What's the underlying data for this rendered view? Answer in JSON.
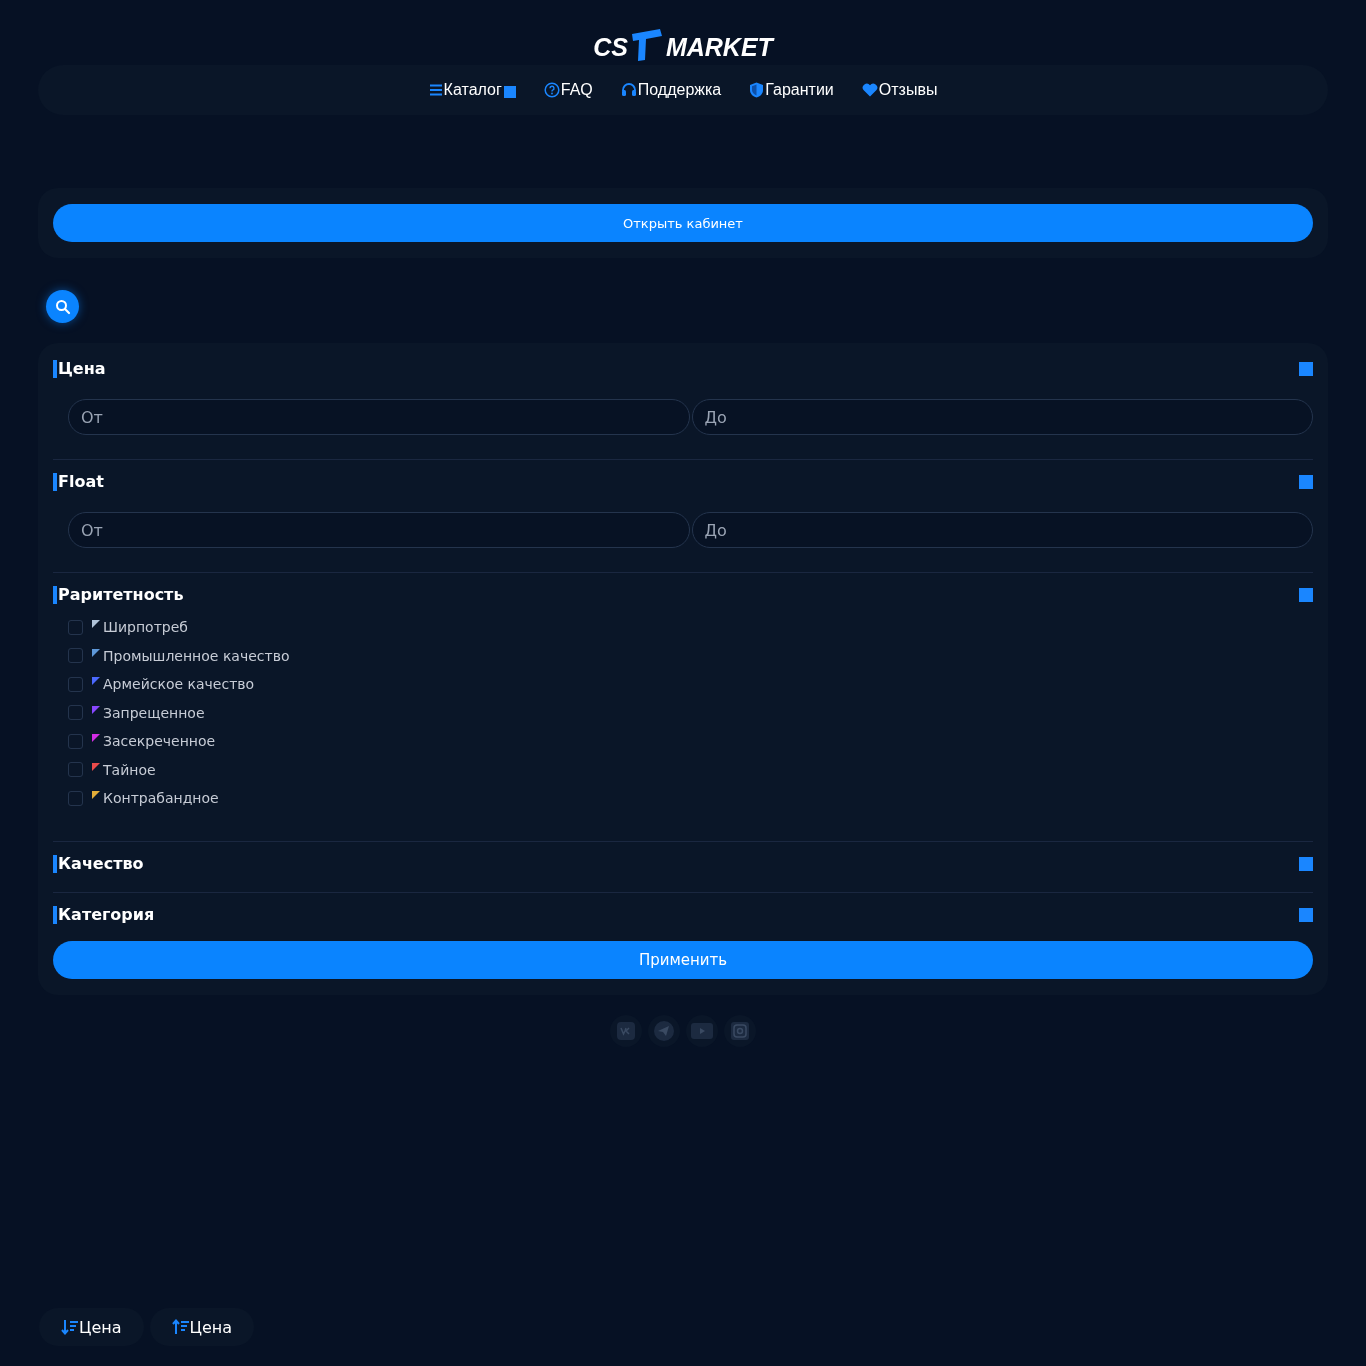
{
  "logo": {
    "left": "CS",
    "right": "MARKET"
  },
  "nav": [
    {
      "label": "Каталог"
    },
    {
      "label": "FAQ"
    },
    {
      "label": "Поддержка"
    },
    {
      "label": "Гарантии"
    },
    {
      "label": "Отзывы"
    }
  ],
  "cabinet_button": "Открыть кабинет",
  "filters": [
    {
      "kind": "range",
      "title": "Цена",
      "from_placeholder": "От",
      "to_placeholder": "До"
    },
    {
      "kind": "range",
      "title": "Float",
      "from_placeholder": "От",
      "to_placeholder": "До"
    },
    {
      "kind": "checklist",
      "title": "Раритетность",
      "items": [
        {
          "label": "Ширпотреб",
          "checked": false,
          "color": "#b0c3d9"
        },
        {
          "label": "Промышленное качество",
          "checked": false,
          "color": "#5e98d9"
        },
        {
          "label": "Армейское качество",
          "checked": false,
          "color": "#4b69ff"
        },
        {
          "label": "Запрещенное",
          "checked": false,
          "color": "#8847ff"
        },
        {
          "label": "Засекреченное",
          "checked": false,
          "color": "#d32ce6"
        },
        {
          "label": "Тайное",
          "checked": false,
          "color": "#eb4b4b"
        },
        {
          "label": "Контрабандное",
          "checked": false,
          "color": "#e4ae39"
        }
      ]
    },
    {
      "title": "Качество"
    },
    {
      "title": "Категория"
    }
  ],
  "apply_button": "Применить",
  "sort_buttons": [
    {
      "label": "Цена"
    },
    {
      "label": "Цена"
    }
  ]
}
